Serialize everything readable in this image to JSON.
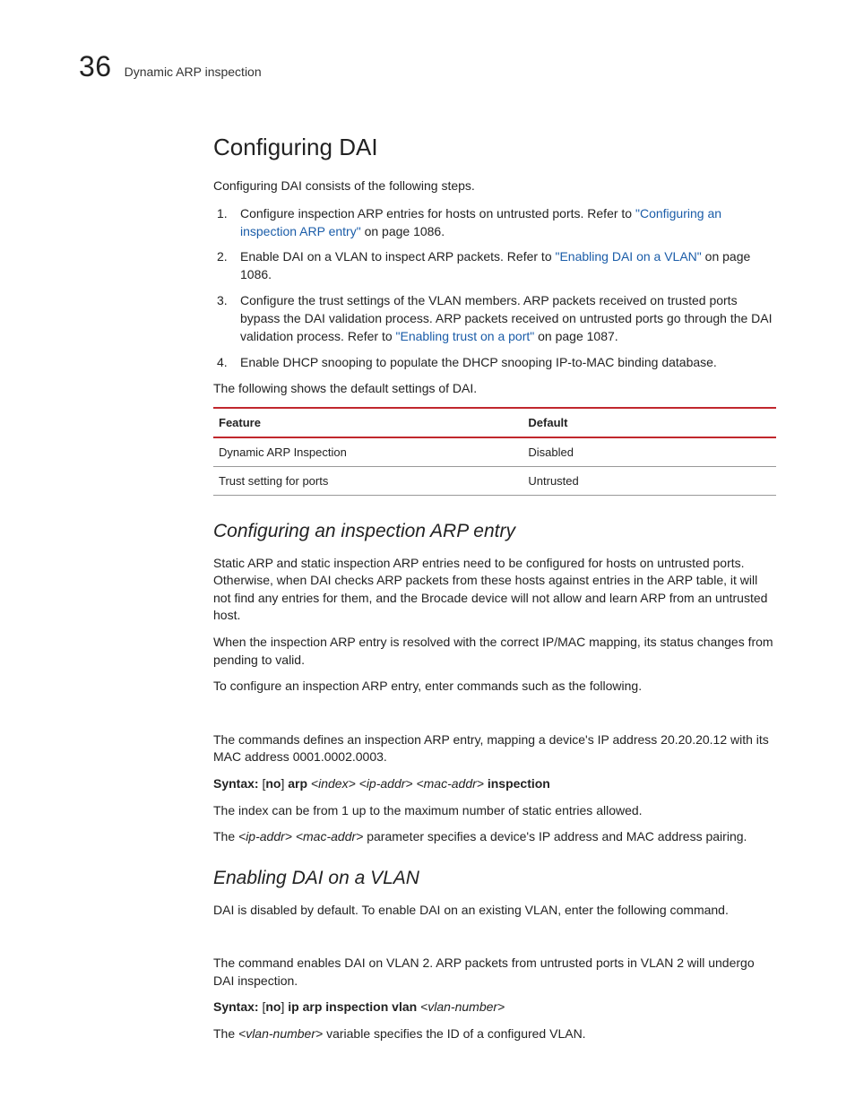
{
  "header": {
    "chapter_number": "36",
    "chapter_label": "Dynamic ARP inspection"
  },
  "title": "Configuring DAI",
  "intro": "Configuring DAI consists of the following steps.",
  "steps": [
    {
      "pre": "Configure inspection ARP entries for hosts on untrusted ports. Refer to ",
      "link": "\"Configuring an inspection ARP entry\"",
      "post": " on page 1086."
    },
    {
      "pre": "Enable DAI on a VLAN to inspect ARP packets. Refer to ",
      "link": "\"Enabling DAI on a VLAN\"",
      "post": " on page 1086."
    },
    {
      "pre": "Configure the trust settings of the VLAN members. ARP packets received on trusted ports bypass the DAI validation process. ARP packets received on untrusted ports go through the DAI validation process. Refer to ",
      "link": "\"Enabling trust on a port\"",
      "post": " on page 1087."
    },
    {
      "pre": "Enable DHCP snooping to populate the DHCP snooping IP-to-MAC binding database.",
      "link": "",
      "post": ""
    }
  ],
  "defaults_intro": "The following shows the default settings of DAI.",
  "table": {
    "head_feature": "Feature",
    "head_default": "Default",
    "rows": [
      {
        "feature": "Dynamic ARP Inspection",
        "default": "Disabled"
      },
      {
        "feature": "Trust setting for ports",
        "default": "Untrusted"
      }
    ]
  },
  "sub1": {
    "title": "Configuring an inspection ARP entry",
    "p1": "Static ARP and static inspection ARP entries need to be configured for hosts on untrusted ports. Otherwise, when DAI checks ARP packets from these hosts against entries in the ARP table, it will not find any entries for them, and the Brocade device will not allow and learn ARP from an untrusted host.",
    "p2": "When the inspection ARP entry is resolved with the correct IP/MAC mapping, its status changes from pending to valid.",
    "p3": "To configure an inspection ARP entry, enter commands such as the following.",
    "p4": "The commands defines an inspection ARP entry, mapping a device's IP address 20.20.20.12 with its MAC address 0001.0002.0003.",
    "syntax": {
      "label": "Syntax:",
      "parts": {
        "a": " [",
        "b": "no",
        "c": "] ",
        "d": "arp",
        "e": " <index> <ip-addr> <mac-addr> ",
        "f": "inspection"
      }
    },
    "p5": "The index can be from 1 up to the maximum number of static entries allowed.",
    "p6_pre": "The ",
    "p6_ital": "<ip-addr> <mac-addr>",
    "p6_post": " parameter specifies a device's IP address and MAC address pairing."
  },
  "sub2": {
    "title": "Enabling DAI on a VLAN",
    "p1": "DAI is disabled by default. To enable DAI on an existing VLAN, enter the following command.",
    "p2": "The command enables DAI on VLAN 2. ARP packets from untrusted ports in VLAN 2 will undergo DAI inspection.",
    "syntax": {
      "label": "Syntax:",
      "parts": {
        "a": " [",
        "b": "no",
        "c": "] ",
        "d": "ip arp inspection vlan",
        "e": " <vlan-number>"
      }
    },
    "p3_pre": "The ",
    "p3_ital": "<vlan-number>",
    "p3_post": " variable specifies the ID of a configured VLAN."
  }
}
